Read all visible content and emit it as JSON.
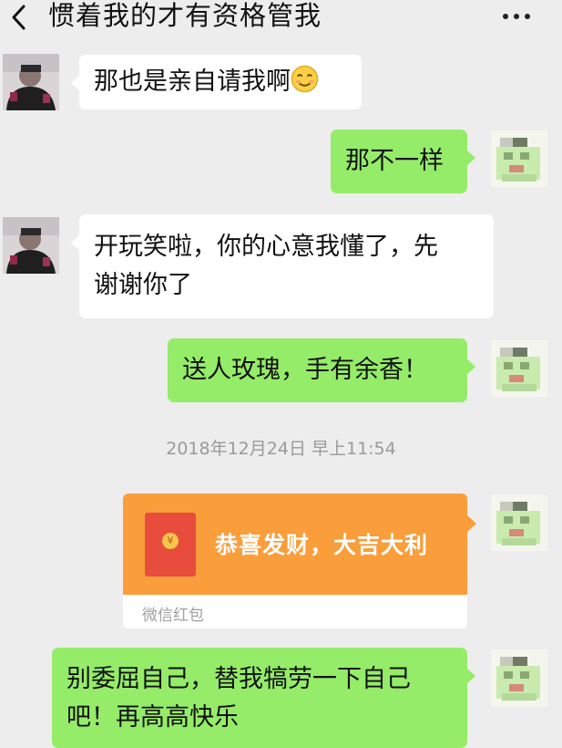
{
  "header": {
    "title": "惯着我的才有资格管我"
  },
  "messages": {
    "m1": {
      "text": "那也是亲自请我啊",
      "emoji": "smiling-face-icon"
    },
    "m2": {
      "text": "那不一样"
    },
    "m3": {
      "line1": "开玩笑啦，你的心意我懂了，先",
      "line2": "谢谢你了"
    },
    "m4": {
      "text": "送人玫瑰，手有余香！"
    },
    "timestamp": "2018年12月24日 早上11:54",
    "red_packet": {
      "greeting": "恭喜发财，大吉大利",
      "label": "微信红包",
      "symbol": "¥"
    },
    "m6": {
      "line1": "别委屈自己，替我犒劳一下自己",
      "line2": "吧！再高高快乐"
    }
  },
  "colors": {
    "background": "#ededed",
    "sent_bubble": "#95ec69",
    "received_bubble": "#ffffff",
    "red_packet": "#fa9d3b"
  }
}
